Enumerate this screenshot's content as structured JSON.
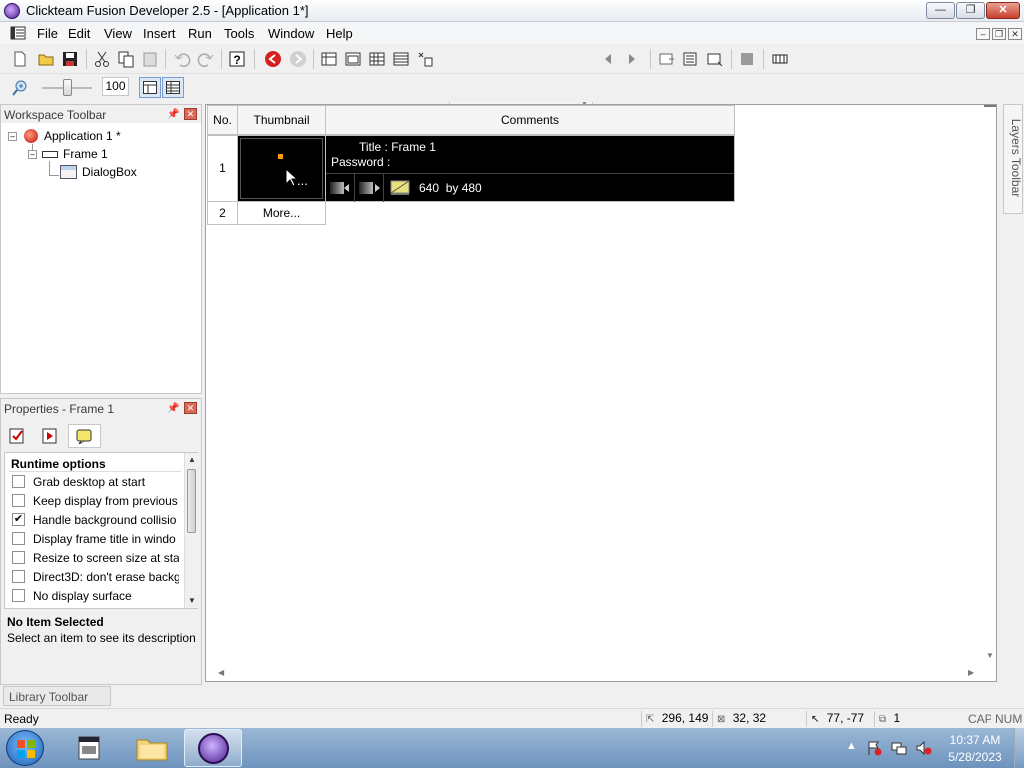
{
  "window": {
    "title": "Clickteam Fusion Developer 2.5 - [Application 1*]",
    "minimize_label": "—",
    "maximize_label": "❐",
    "close_label": "✕"
  },
  "menu": {
    "items": [
      "File",
      "Edit",
      "View",
      "Insert",
      "Run",
      "Tools",
      "Window",
      "Help"
    ]
  },
  "toolbar": {
    "zoom_value": "100"
  },
  "workspace": {
    "header": "Workspace Toolbar",
    "tree": {
      "application": "Application 1 *",
      "frame": "Frame 1",
      "object": "DialogBox"
    }
  },
  "properties": {
    "header": "Properties - Frame 1",
    "section": "Runtime options",
    "options": [
      {
        "label": "Grab desktop at start",
        "checked": false
      },
      {
        "label": "Keep display from previous",
        "checked": false
      },
      {
        "label": "Handle background collisio",
        "checked": true
      },
      {
        "label": "Display frame title in windo",
        "checked": false
      },
      {
        "label": "Resize to screen size at start",
        "checked": false
      },
      {
        "label": "Direct3D: don't erase backg",
        "checked": false
      },
      {
        "label": "No display surface",
        "checked": false
      }
    ],
    "desc_title": "No Item Selected",
    "desc_text": "Select an item to see its description"
  },
  "storyboard": {
    "col_no": "No.",
    "col_thumb": "Thumbnail",
    "col_comments": "Comments",
    "row1_no": "1",
    "row1_thumb_dots": "...",
    "row1_title": "Title : Frame 1",
    "row1_password": "Password :",
    "row1_size": "640  by 480",
    "row2_no": "2",
    "row2_more": "More..."
  },
  "layers_toolbar": "Layers Toolbar",
  "library_toolbar": "Library Toolbar",
  "status": {
    "text": "Ready",
    "pos": "296, 149",
    "size": "32, 32",
    "hotspot": "77, -77",
    "count": "1",
    "cap": "CAP",
    "num": "NUM"
  },
  "taskbar": {
    "time": "10:37 AM",
    "date": "5/28/2023"
  },
  "colors": {
    "accent": "#c00000",
    "selection": "#3399ff"
  }
}
